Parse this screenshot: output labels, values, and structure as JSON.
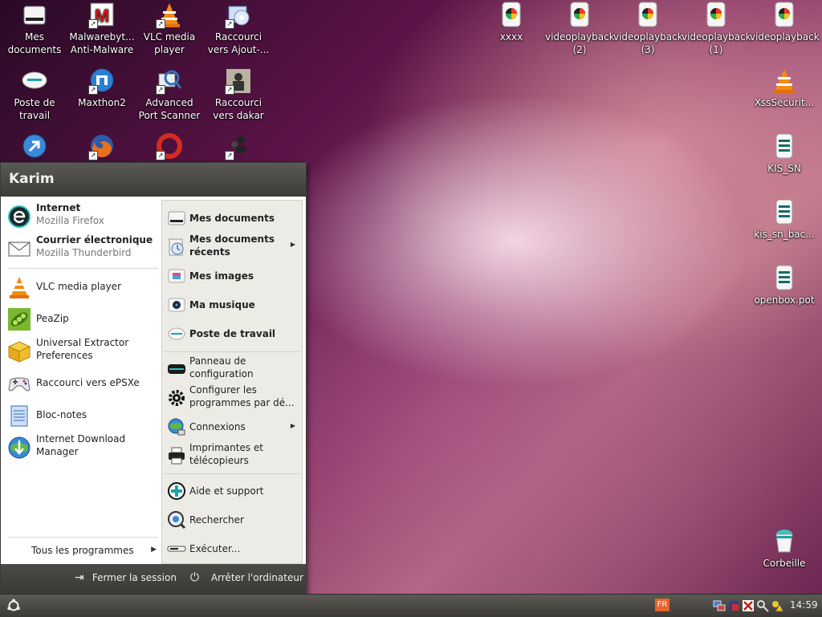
{
  "desktop": {
    "icons_left": [
      {
        "label": "Mes\ndocuments",
        "icon": "drive-icon"
      },
      {
        "label": "Malwarebyt...\nAnti-Malware",
        "icon": "malwarebytes-icon"
      },
      {
        "label": "VLC media\nplayer",
        "icon": "vlc-icon"
      },
      {
        "label": "Raccourci\nvers Ajout-...",
        "icon": "installer-icon"
      },
      {
        "label": "Poste de\ntravail",
        "icon": "computer-icon"
      },
      {
        "label": "Maxthon2",
        "icon": "maxthon-icon"
      },
      {
        "label": "Advanced\nPort Scanner",
        "icon": "port-scanner-icon"
      },
      {
        "label": "Raccourci\nvers dakar",
        "icon": "dakar-icon"
      }
    ],
    "icons_right": [
      {
        "label": "xxxx",
        "icon": "video-icon"
      },
      {
        "label": "videoplayback\n(2)",
        "icon": "video-icon"
      },
      {
        "label": "videoplayback\n(3)",
        "icon": "video-icon"
      },
      {
        "label": "videoplayback\n(1)",
        "icon": "video-icon"
      },
      {
        "label": "videoplayback",
        "icon": "video-icon"
      },
      {
        "label": "XssSecurit...",
        "icon": "vlc-icon"
      },
      {
        "label": "KIS_SN",
        "icon": "document-icon"
      },
      {
        "label": "kis_sn_bac...",
        "icon": "document-icon"
      },
      {
        "label": "openbox.pot",
        "icon": "document-icon"
      },
      {
        "label": "Corbeille",
        "icon": "trash-icon"
      }
    ]
  },
  "start_menu": {
    "user": "Karim",
    "pinned": [
      {
        "title": "Internet",
        "sub": "Mozilla Firefox"
      },
      {
        "title": "Courrier électronique",
        "sub": "Mozilla Thunderbird"
      }
    ],
    "recent": [
      {
        "title": "VLC media player"
      },
      {
        "title": "PeaZip"
      },
      {
        "title": "Universal Extractor\nPreferences"
      },
      {
        "title": "Raccourci vers ePSXe"
      },
      {
        "title": "Bloc-notes"
      },
      {
        "title": "Internet Download\nManager"
      }
    ],
    "all_programs": "Tous les programmes",
    "places": [
      {
        "label": "Mes documents"
      },
      {
        "label": "Mes documents\nrécents"
      },
      {
        "label": "Mes images"
      },
      {
        "label": "Ma musique"
      },
      {
        "label": "Poste de travail"
      }
    ],
    "system": [
      {
        "label": "Panneau de\nconfiguration"
      },
      {
        "label": "Configurer les\nprogrammes par dé..."
      },
      {
        "label": "Connexions"
      },
      {
        "label": "Imprimantes et\ntélécopieurs"
      }
    ],
    "help": [
      {
        "label": "Aide et support"
      },
      {
        "label": "Rechercher"
      },
      {
        "label": "Exécuter..."
      }
    ],
    "logout": "Fermer la session",
    "shutdown": "Arrêter l'ordinateur"
  },
  "taskbar": {
    "language": "FR",
    "clock": "14:59"
  },
  "colors": {
    "accent_orange": "#e8632a",
    "panel_dark": "#3c3b37"
  }
}
